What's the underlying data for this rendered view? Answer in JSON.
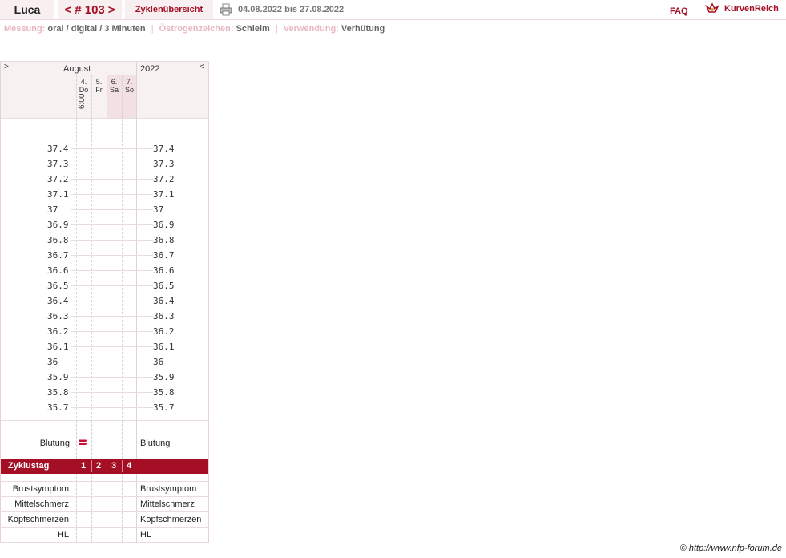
{
  "header": {
    "name": "Luca",
    "cycle_prev": "<",
    "cycle_number": "# 103",
    "cycle_next": ">",
    "overview_label": "Zyklenübersicht",
    "date_range": "04.08.2022 bis 27.08.2022",
    "faq_label": "FAQ",
    "logo_text": "KurvenReich"
  },
  "info": {
    "measurement_label": "Messung:",
    "measurement_value": "oral / digital / 3 Minuten",
    "estrogen_label": "Östrogenzeichen:",
    "estrogen_value": "Schleim",
    "usage_label": "Verwendung:",
    "usage_value": "Verhütung"
  },
  "chart": {
    "nav_left": ">",
    "nav_right": "<",
    "month": "August",
    "year": "2022",
    "days": [
      {
        "num": "4.",
        "dow": "Do",
        "time": "6:00"
      },
      {
        "num": "5.",
        "dow": "Fr",
        "time": ""
      },
      {
        "num": "6.",
        "dow": "Sa",
        "time": ""
      },
      {
        "num": "7.",
        "dow": "So",
        "time": ""
      }
    ],
    "temps_left": [
      "37.4",
      "37.3",
      "37.2",
      "37.1",
      "37",
      "36.9",
      "36.8",
      "36.7",
      "36.6",
      "36.5",
      "36.4",
      "36.3",
      "36.2",
      "36.1",
      "36",
      "35.9",
      "35.8",
      "35.7"
    ],
    "temps_right": [
      "37.4",
      "37.3",
      "37.2",
      "37.1",
      "37",
      "36.9",
      "36.8",
      "36.7",
      "36.6",
      "36.5",
      "36.4",
      "36.3",
      "36.2",
      "36.1",
      "36",
      "35.9",
      "35.8",
      "35.7"
    ],
    "bleeding_label": "Blutung",
    "bleeding_label_right": "Blutung",
    "cycle_day_label": "Zyklustag",
    "cycle_days": [
      "1",
      "2",
      "3",
      "4"
    ],
    "symptoms": [
      "Brustsymptom",
      "Mittelschmerz",
      "Kopfschmerzen",
      "HL"
    ],
    "symptoms_right": [
      "Brustsymptom",
      "Mittelschmerz",
      "Kopfschmerzen",
      "HL"
    ]
  },
  "footer": {
    "copyright": "© http://www.nfp-forum.de"
  },
  "colors": {
    "accent": "#a40f25",
    "panel": "#f8f1f2",
    "label_pink": "#e9b7bf"
  }
}
